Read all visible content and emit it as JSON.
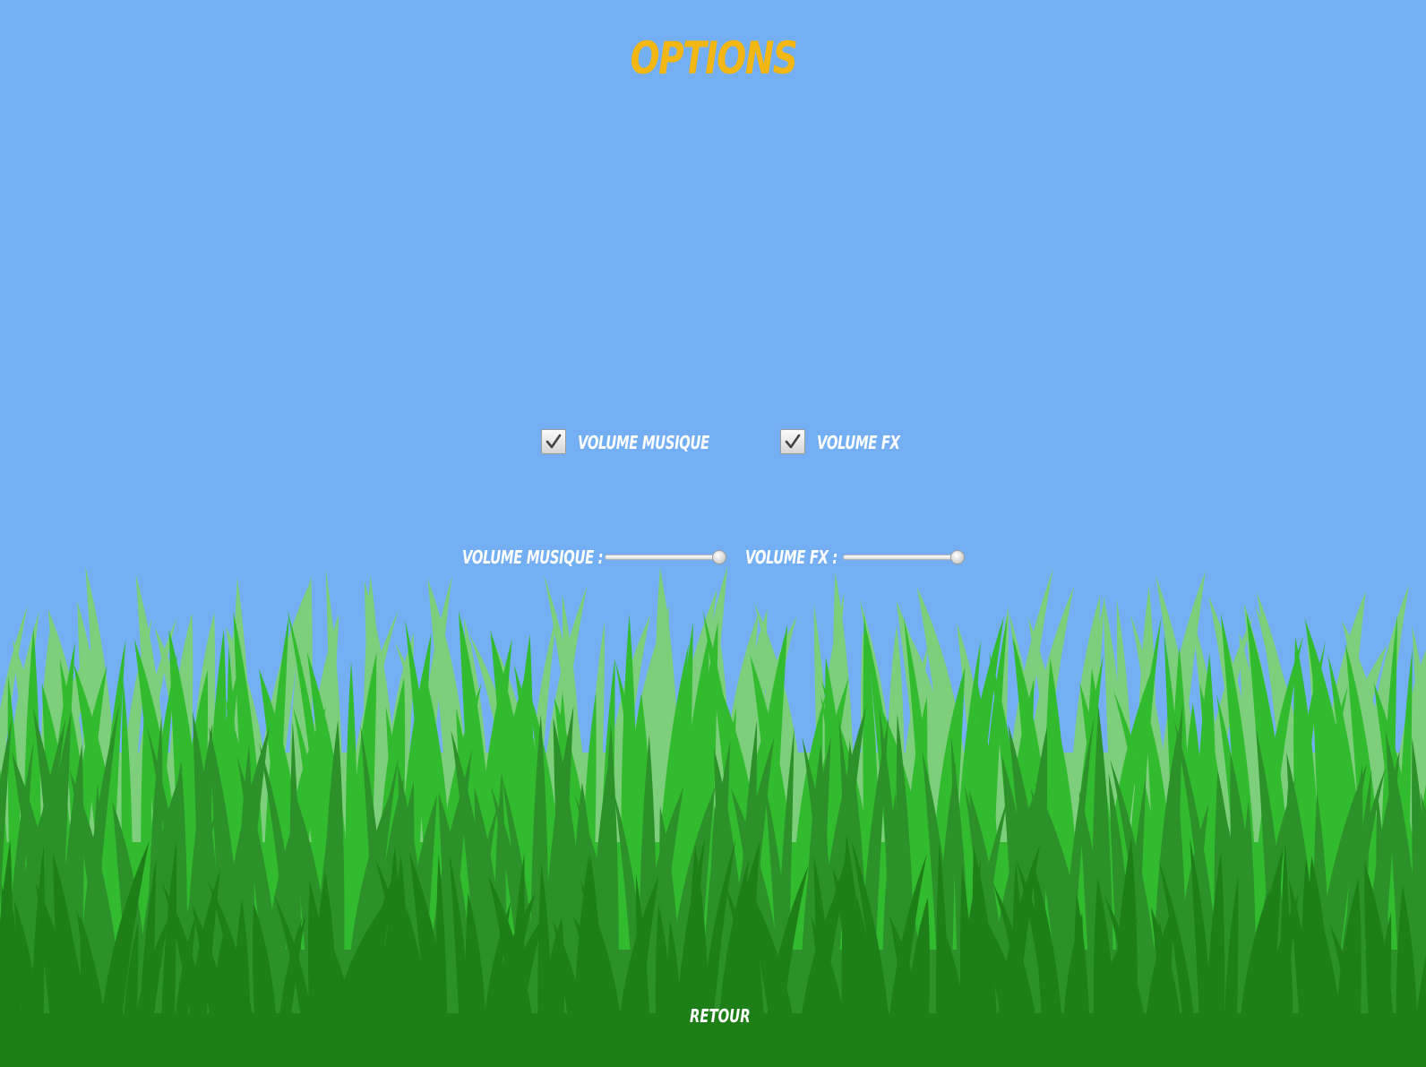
{
  "screen": {
    "title": "OPTIONS",
    "sky_color": "#74aff4",
    "title_color": "#f2b713"
  },
  "toggles": [
    {
      "label": "VOLUME MUSIQUE",
      "checked": true,
      "icon": "checkmark-icon"
    },
    {
      "label": "VOLUME FX",
      "checked": true,
      "icon": "checkmark-icon"
    }
  ],
  "sliders": [
    {
      "label": "VOLUME MUSIQUE :",
      "value": 1.0
    },
    {
      "label": "VOLUME FX :",
      "value": 1.0
    }
  ],
  "footer": {
    "back_label": "RETOUR"
  },
  "background": {
    "grass_colors": [
      "#7dcf7c",
      "#33bb30",
      "#2b9128",
      "#1e7f18"
    ]
  }
}
